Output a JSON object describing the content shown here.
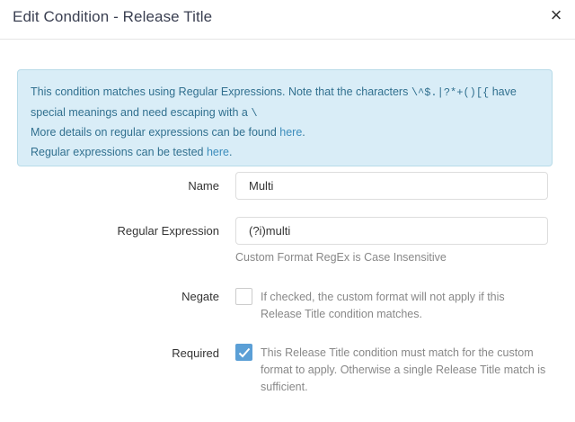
{
  "dialog": {
    "title": "Edit Condition - Release Title",
    "close_symbol": "×"
  },
  "info": {
    "line1_prefix": "This condition matches using Regular Expressions. Note that the characters ",
    "line1_chars": "\\^$.|?*+()[{",
    "line1_suffix": " have",
    "line2_prefix": "special meanings and need escaping with a ",
    "line2_char": "\\",
    "line3_prefix": "More details on regular expressions can be found ",
    "line3_link": "here",
    "line3_suffix": ".",
    "line4_prefix": "Regular expressions can be tested ",
    "line4_link": "here",
    "line4_suffix": ".",
    "colors": {
      "background": "#d9edf7",
      "text": "#31708f",
      "link": "#3c8dbc"
    }
  },
  "form": {
    "name": {
      "label": "Name",
      "value": "Multi"
    },
    "regex": {
      "label": "Regular Expression",
      "value": "(?i)multi",
      "help": "Custom Format RegEx is Case Insensitive"
    },
    "negate": {
      "label": "Negate",
      "checked": false,
      "help": "If checked, the custom format will not apply if this Release Title condition matches."
    },
    "required": {
      "label": "Required",
      "checked": true,
      "help": "This Release Title condition must match for the custom format to apply. Otherwise a single Release Title match is sufficient."
    }
  },
  "colors": {
    "checkbox_checked": "#5b9fd6"
  }
}
